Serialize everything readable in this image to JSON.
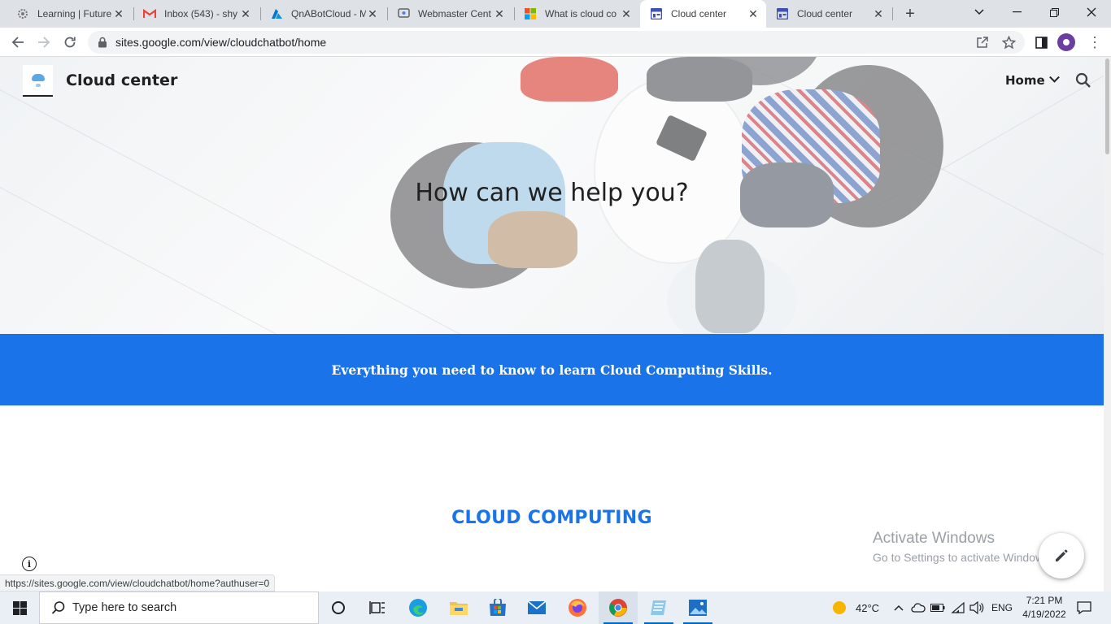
{
  "browser": {
    "tabs": [
      {
        "title": "Learning | Future",
        "favicon": "gear-icon",
        "active": false
      },
      {
        "title": "Inbox (543) - shy",
        "favicon": "gmail-icon",
        "active": false
      },
      {
        "title": "QnABotCloud - M",
        "favicon": "azure-icon",
        "active": false
      },
      {
        "title": "Webmaster Cent",
        "favicon": "webmaster-icon",
        "active": false
      },
      {
        "title": "What is cloud co",
        "favicon": "microsoft-icon",
        "active": false
      },
      {
        "title": "Cloud center",
        "favicon": "google-sites-icon",
        "active": true
      },
      {
        "title": "Cloud center",
        "favicon": "google-sites-icon",
        "active": false
      }
    ],
    "address_url": "sites.google.com/view/cloudchatbot/home",
    "status_url": "https://sites.google.com/view/cloudchatbot/home?authuser=0"
  },
  "site": {
    "title": "Cloud center",
    "nav_home": "Home",
    "hero_heading": "How can we help you?",
    "band_text": "Everything you need to know to learn Cloud Computing Skills.",
    "section_heading": "CLOUD COMPUTING",
    "accent_color": "#1a73e8"
  },
  "watermark": {
    "line1": "Activate Windows",
    "line2": "Go to Settings to activate Windows."
  },
  "taskbar": {
    "search_placeholder": "Type here to search",
    "temperature": "42°C",
    "language": "ENG",
    "time": "7:21 PM",
    "date": "4/19/2022"
  }
}
